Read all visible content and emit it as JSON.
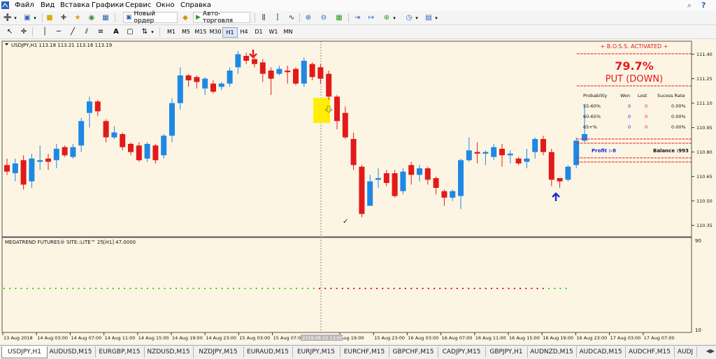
{
  "menu": {
    "items": [
      "Файл",
      "Вид",
      "Вставка",
      "Графики",
      "Сервис",
      "Окно",
      "Справка"
    ]
  },
  "toolbar": {
    "new_order": "Новый ордер",
    "auto_trading": "Авто-торговля",
    "timeframes": [
      "M1",
      "M5",
      "M15",
      "M30",
      "H1",
      "H4",
      "D1",
      "W1",
      "MN"
    ],
    "active_timeframe": "H1"
  },
  "chart": {
    "header": "USDJPY,H1  113.18 113.21 113.16 113.19",
    "price_labels": [
      "111.40",
      "111.25",
      "111.10",
      "110.95",
      "110.80",
      "110.65",
      "110.50",
      "110.35"
    ],
    "time_labels": [
      "13 Aug 2018",
      "14 Aug 03:00",
      "14 Aug 07:00",
      "14 Aug 11:00",
      "14 Aug 15:00",
      "14 Aug 19:00",
      "14 Aug 23:00",
      "15 Aug 03:00",
      "15 Aug 07:00",
      "2018.08.15 13:00",
      "Aug 19:00",
      "15 Aug 23:00",
      "16 Aug 03:00",
      "16 Aug 07:00",
      "16 Aug 11:00",
      "16 Aug 15:00",
      "16 Aug 19:00",
      "16 Aug 23:00",
      "17 Aug 03:00",
      "17 Aug 07:00"
    ],
    "crosshair_label": "2018.08.15 13:00",
    "check_mark": "✓",
    "up_color": "#1e88e5",
    "down_color": "#e21a1a",
    "background": "#fdf5e4"
  },
  "panel": {
    "title": "+ B.O.S.S. ACTIVATED +",
    "separator": "=================================",
    "percent": "79.7%",
    "direction": "PUT (DOWN)",
    "headers": [
      "Probability",
      "Won",
      "Lost",
      "Sucess Rate"
    ],
    "rows": [
      {
        "prob": "55-60%",
        "won": "0",
        "lost": "0",
        "rate": "0.00%"
      },
      {
        "prob": "60-65%",
        "won": "0",
        "lost": "0",
        "rate": "0.00%"
      },
      {
        "prob": "65+%",
        "won": "0",
        "lost": "0",
        "rate": "0.00%"
      }
    ],
    "profit": "Profit :-8",
    "balance": "Balance :993"
  },
  "indicator": {
    "header": "MEGATREND FUTURES®    SITE::LITE™   25[H1] 47.0000",
    "scale_top": "90",
    "scale_bottom": "10",
    "green_color": "#22dd22",
    "red_color": "#e21a1a"
  },
  "tabs": {
    "items": [
      "USDJPY,H1",
      "AUDUSD,M15",
      "EURGBP,M15",
      "NZDUSD,M15",
      "NZDJPY,M15",
      "EURAUD,M15",
      "EURJPY,M15",
      "EURCHF,M15",
      "GBPCHF,M15",
      "CADJPY,M15",
      "GBPJPY,H1",
      "AUDNZD,M15",
      "AUDCAD,M15",
      "AUDCHF,M15",
      "AUDJ"
    ],
    "active": "USDJPY,H1"
  },
  "chart_data": {
    "type": "candlestick",
    "symbol": "USDJPY",
    "timeframe": "H1",
    "ylim": [
      110.28,
      111.48
    ],
    "candles": [
      [
        110.72,
        110.68,
        110.76,
        110.66
      ],
      [
        110.67,
        110.73,
        110.76,
        110.62
      ],
      [
        110.75,
        110.6,
        110.78,
        110.57
      ],
      [
        110.62,
        110.76,
        110.79,
        110.58
      ],
      [
        110.74,
        110.75,
        110.84,
        110.69
      ],
      [
        110.76,
        110.74,
        110.79,
        110.69
      ],
      [
        110.75,
        110.82,
        110.85,
        110.7
      ],
      [
        110.83,
        110.78,
        110.84,
        110.77
      ],
      [
        110.77,
        110.83,
        110.85,
        110.76
      ],
      [
        110.84,
        110.99,
        111.01,
        110.8
      ],
      [
        111.04,
        111.11,
        111.14,
        110.95
      ],
      [
        111.11,
        111.05,
        111.12,
        111.02
      ],
      [
        110.99,
        110.89,
        111.0,
        110.86
      ],
      [
        110.89,
        110.92,
        110.96,
        110.88
      ],
      [
        110.91,
        110.83,
        110.92,
        110.81
      ],
      [
        110.85,
        110.8,
        110.86,
        110.78
      ],
      [
        110.84,
        110.75,
        110.86,
        110.74
      ],
      [
        110.76,
        110.85,
        110.86,
        110.74
      ],
      [
        110.84,
        110.75,
        110.85,
        110.73
      ],
      [
        110.78,
        110.9,
        110.91,
        110.76
      ],
      [
        110.9,
        111.1,
        111.13,
        110.86
      ],
      [
        111.1,
        111.27,
        111.32,
        111.06
      ],
      [
        111.27,
        111.24,
        111.28,
        111.2
      ],
      [
        111.26,
        111.23,
        111.27,
        111.19
      ],
      [
        111.19,
        111.25,
        111.26,
        111.15
      ],
      [
        111.22,
        111.17,
        111.24,
        111.16
      ],
      [
        111.2,
        111.22,
        111.23,
        111.18
      ],
      [
        111.22,
        111.3,
        111.32,
        111.2
      ],
      [
        111.32,
        111.4,
        111.42,
        111.28
      ],
      [
        111.39,
        111.36,
        111.41,
        111.34
      ],
      [
        111.37,
        111.34,
        111.38,
        111.32
      ],
      [
        111.35,
        111.28,
        111.37,
        111.23
      ],
      [
        111.3,
        111.25,
        111.32,
        111.15
      ],
      [
        111.28,
        111.31,
        111.33,
        111.27
      ],
      [
        111.3,
        111.29,
        111.33,
        111.22
      ],
      [
        111.31,
        111.22,
        111.32,
        111.21
      ],
      [
        111.22,
        111.36,
        111.38,
        111.2
      ],
      [
        111.34,
        111.26,
        111.35,
        111.24
      ],
      [
        111.32,
        111.25,
        111.34,
        111.22
      ],
      [
        111.28,
        111.14,
        111.3,
        111.12
      ],
      [
        111.14,
        110.99,
        111.15,
        110.94
      ],
      [
        111.04,
        110.89,
        111.08,
        110.88
      ],
      [
        110.88,
        110.72,
        110.92,
        110.69
      ],
      [
        110.71,
        110.42,
        110.72,
        110.4
      ],
      [
        110.47,
        110.62,
        110.66,
        110.47
      ],
      [
        110.63,
        110.64,
        110.7,
        110.58
      ],
      [
        110.67,
        110.61,
        110.69,
        110.59
      ],
      [
        110.67,
        110.53,
        110.69,
        110.52
      ],
      [
        110.56,
        110.68,
        110.7,
        110.54
      ],
      [
        110.72,
        110.66,
        110.74,
        110.6
      ],
      [
        110.66,
        110.7,
        110.72,
        110.62
      ],
      [
        110.7,
        110.63,
        110.71,
        110.6
      ],
      [
        110.64,
        110.58,
        110.65,
        110.54
      ],
      [
        110.56,
        110.52,
        110.57,
        110.47
      ],
      [
        110.52,
        110.56,
        110.57,
        110.5
      ],
      [
        110.53,
        110.75,
        110.76,
        110.45
      ],
      [
        110.75,
        110.81,
        110.89,
        110.74
      ],
      [
        110.8,
        110.79,
        110.86,
        110.73
      ],
      [
        110.79,
        110.8,
        110.81,
        110.72
      ],
      [
        110.77,
        110.83,
        110.85,
        110.75
      ],
      [
        110.82,
        110.78,
        110.85,
        110.71
      ],
      [
        110.78,
        110.79,
        110.81,
        110.73
      ],
      [
        110.76,
        110.73,
        110.77,
        110.72
      ],
      [
        110.74,
        110.76,
        110.82,
        110.7
      ],
      [
        110.8,
        110.88,
        110.89,
        110.76
      ],
      [
        110.88,
        110.8,
        110.9,
        110.78
      ],
      [
        110.8,
        110.63,
        110.82,
        110.59
      ],
      [
        110.64,
        110.62,
        110.64,
        110.58
      ],
      [
        110.63,
        110.71,
        110.72,
        110.62
      ],
      [
        110.72,
        110.87,
        110.89,
        110.7
      ],
      [
        110.87,
        110.91,
        111.09,
        110.86
      ]
    ]
  }
}
